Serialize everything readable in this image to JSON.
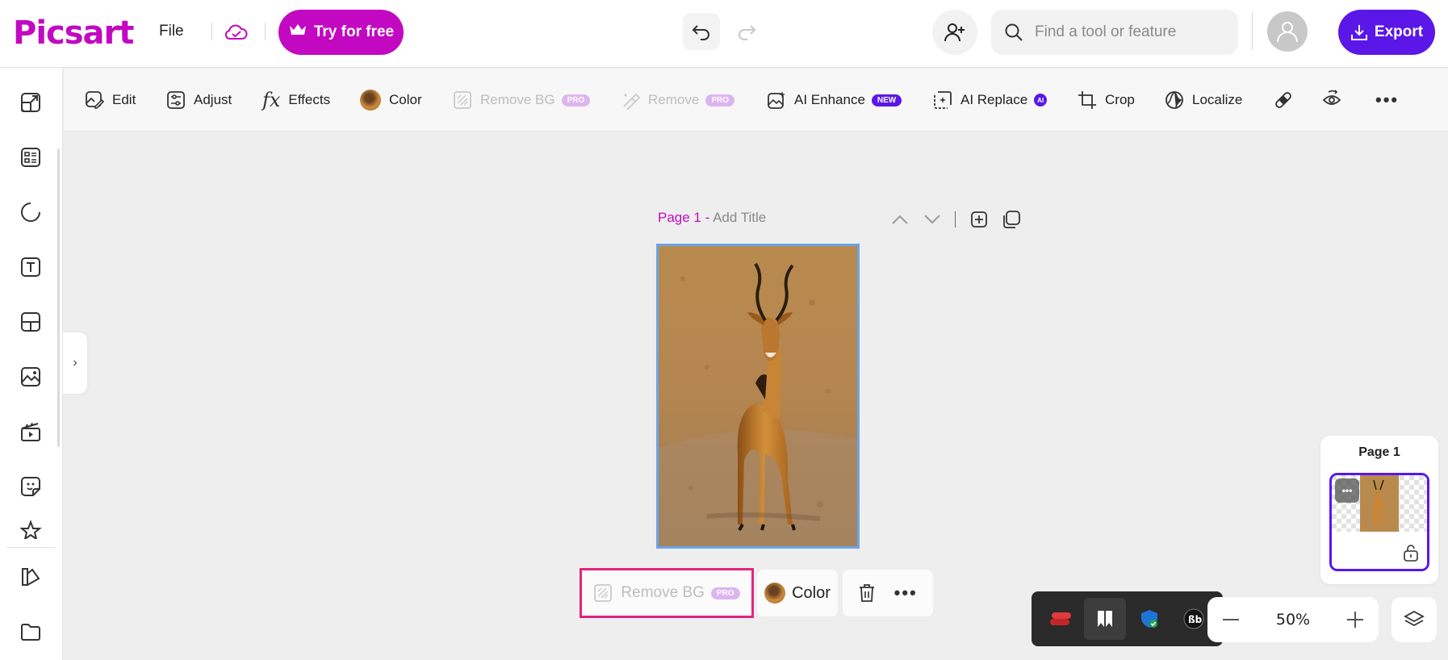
{
  "header": {
    "logo": "Picsart",
    "file_label": "File",
    "try_label": "Try for free",
    "search_placeholder": "Find a tool or feature",
    "export_label": "Export"
  },
  "toolbar": {
    "tools": [
      {
        "label": "Edit",
        "icon": "edit-image-icon"
      },
      {
        "label": "Adjust",
        "icon": "sliders-icon"
      },
      {
        "label": "Effects",
        "icon": "fx-icon"
      },
      {
        "label": "Color",
        "icon": "color-swatch-icon"
      },
      {
        "label": "Remove BG",
        "icon": "remove-bg-icon",
        "badge": "PRO",
        "disabled": true
      },
      {
        "label": "Remove",
        "icon": "eraser-brush-icon",
        "badge": "PRO",
        "disabled": true
      },
      {
        "label": "AI Enhance",
        "icon": "ai-enhance-icon",
        "badge": "NEW"
      },
      {
        "label": "AI Replace",
        "icon": "ai-replace-icon",
        "badge": "AI"
      },
      {
        "label": "Crop",
        "icon": "crop-icon"
      },
      {
        "label": "Localize",
        "icon": "globe-icon"
      }
    ]
  },
  "canvas": {
    "page_label": "Page 1 -",
    "add_title": "Add Title"
  },
  "context_bar": {
    "remove_bg_label": "Remove BG",
    "remove_bg_badge": "PRO",
    "color_label": "Color"
  },
  "pages_panel": {
    "title": "Page 1"
  },
  "zoom": {
    "value": "50%"
  },
  "colors": {
    "brand": "#c209c1",
    "export": "#5a17e8",
    "selection_highlight": "#e0257f",
    "canvas_border": "#6aa6e6"
  }
}
